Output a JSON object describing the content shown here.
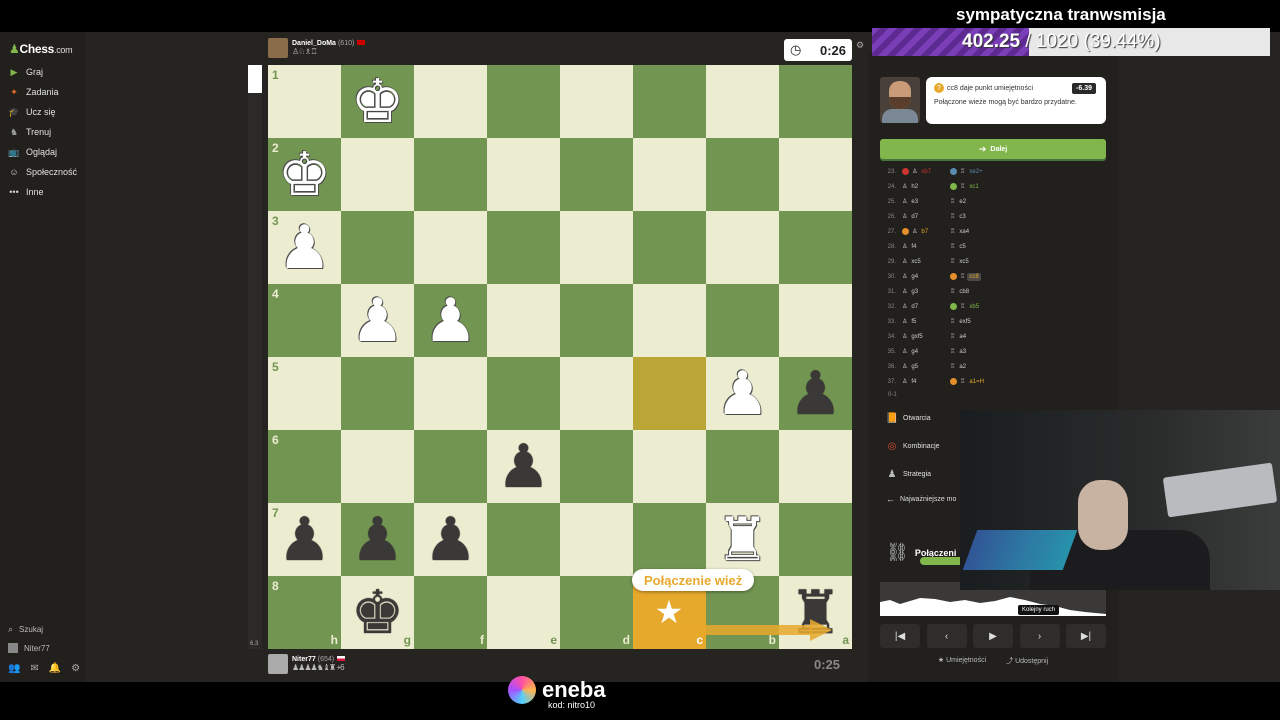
{
  "app": {
    "logo_text": "Chess",
    "logo_domain": ".com"
  },
  "sidebar": {
    "items": [
      {
        "label": "Graj",
        "icon": "play-icon",
        "color": "#81b64c"
      },
      {
        "label": "Zadania",
        "icon": "puzzle-icon",
        "color": "#e76b2a"
      },
      {
        "label": "Ucz się",
        "icon": "learn-icon",
        "color": "#4aa7c9"
      },
      {
        "label": "Trenuj",
        "icon": "train-icon",
        "color": "#a0a0a0"
      },
      {
        "label": "Oglądaj",
        "icon": "watch-icon",
        "color": "#d0d0d0"
      },
      {
        "label": "Społeczność",
        "icon": "community-icon",
        "color": "#d0d0d0"
      },
      {
        "label": "Inne",
        "icon": "more-icon",
        "color": "#d0d0d0"
      }
    ],
    "search_label": "Szukaj",
    "user_label": "Niter77"
  },
  "top_player": {
    "name": "Daniel_DoMa",
    "rating": "(610)",
    "clock": "0:26"
  },
  "bottom_player": {
    "name": "Niter77",
    "rating": "(654)",
    "captured_extra": "+6",
    "clock": "0:25"
  },
  "board": {
    "ranks": [
      "1",
      "2",
      "3",
      "4",
      "5",
      "6",
      "7",
      "8"
    ],
    "files": [
      "h",
      "g",
      "f",
      "e",
      "d",
      "c",
      "b",
      "a"
    ],
    "pieces": [
      {
        "rank": 1,
        "file": "g",
        "piece": "K",
        "color": "w"
      },
      {
        "rank": 2,
        "file": "h",
        "piece": "K",
        "color": "w"
      },
      {
        "rank": 3,
        "file": "h",
        "piece": "P",
        "color": "w"
      },
      {
        "rank": 4,
        "file": "g",
        "piece": "P",
        "color": "w"
      },
      {
        "rank": 4,
        "file": "f",
        "piece": "P",
        "color": "w"
      },
      {
        "rank": 5,
        "file": "b",
        "piece": "P",
        "color": "w"
      },
      {
        "rank": 5,
        "file": "a",
        "piece": "P",
        "color": "b"
      },
      {
        "rank": 6,
        "file": "e",
        "piece": "P",
        "color": "b"
      },
      {
        "rank": 7,
        "file": "h",
        "piece": "P",
        "color": "b"
      },
      {
        "rank": 7,
        "file": "g",
        "piece": "P",
        "color": "b"
      },
      {
        "rank": 7,
        "file": "f",
        "piece": "P",
        "color": "b"
      },
      {
        "rank": 7,
        "file": "b",
        "piece": "R",
        "color": "w"
      },
      {
        "rank": 8,
        "file": "g",
        "piece": "K",
        "color": "b"
      },
      {
        "rank": 8,
        "file": "a",
        "piece": "R",
        "color": "b"
      }
    ],
    "callout": "Połączenie wież",
    "eval_value": "6.3"
  },
  "coach": {
    "move_text": "cc8 daje punkt umiejętności",
    "score": "-6.39",
    "message": "Połączone wieże mogą być bardzo przydatne."
  },
  "next_button": "Dalej",
  "moves": [
    {
      "num": "23.",
      "white": "xb7",
      "wmark": "blunder",
      "wclass": "red",
      "black": "xe2+",
      "bmark": "great",
      "bclass": "blue"
    },
    {
      "num": "24.",
      "white": "h2",
      "wmark": "",
      "wclass": "",
      "black": "xc1",
      "bmark": "best",
      "bclass": "green"
    },
    {
      "num": "25.",
      "white": "e3",
      "wmark": "",
      "wclass": "",
      "black": "e2",
      "bmark": "",
      "bclass": ""
    },
    {
      "num": "26.",
      "white": "d7",
      "wmark": "",
      "wclass": "",
      "black": "c3",
      "bmark": "",
      "bclass": ""
    },
    {
      "num": "27.",
      "white": "b7",
      "wmark": "mistake",
      "wclass": "orange",
      "black": "xa4",
      "bmark": "",
      "bclass": ""
    },
    {
      "num": "28.",
      "white": "f4",
      "wmark": "",
      "wclass": "",
      "black": "c5",
      "bmark": "",
      "bclass": ""
    },
    {
      "num": "29.",
      "white": "xc5",
      "wmark": "",
      "wclass": "",
      "black": "xc5",
      "bmark": "",
      "bclass": ""
    },
    {
      "num": "30.",
      "white": "g4",
      "wmark": "",
      "wclass": "",
      "black": "cc8",
      "bmark": "mistake",
      "bclass": "active"
    },
    {
      "num": "31.",
      "white": "g3",
      "wmark": "",
      "wclass": "",
      "black": "cb8",
      "bmark": "",
      "bclass": ""
    },
    {
      "num": "32.",
      "white": "d7",
      "wmark": "",
      "wclass": "",
      "black": "xb5",
      "bmark": "best",
      "bclass": "green"
    },
    {
      "num": "33.",
      "white": "f5",
      "wmark": "",
      "wclass": "",
      "black": "exf5",
      "bmark": "",
      "bclass": ""
    },
    {
      "num": "34.",
      "white": "gxf5",
      "wmark": "",
      "wclass": "",
      "black": "a4",
      "bmark": "",
      "bclass": ""
    },
    {
      "num": "35.",
      "white": "g4",
      "wmark": "",
      "wclass": "",
      "black": "a3",
      "bmark": "",
      "bclass": ""
    },
    {
      "num": "36.",
      "white": "g5",
      "wmark": "",
      "wclass": "",
      "black": "a2",
      "bmark": "",
      "bclass": ""
    },
    {
      "num": "37.",
      "white": "f4",
      "wmark": "",
      "wclass": "",
      "black": "a1=H",
      "bmark": "mistake",
      "bclass": "orange"
    }
  ],
  "result": "0-1",
  "sections": [
    {
      "label": "Otwarcia",
      "icon": "book-icon",
      "color": "#c89b5a"
    },
    {
      "label": "Kombinacje",
      "icon": "target-icon",
      "color": "#e04a3a"
    },
    {
      "label": "Strategia",
      "icon": "strategy-icon",
      "color": "#bbbbbb"
    }
  ],
  "back_label": "Najważniejsze mo",
  "theme": {
    "name": "Połączeni",
    "progress": 0.5
  },
  "graph_tip": "Kolejny ruch",
  "controls": [
    "first-move-icon",
    "prev-move-icon",
    "play-icon",
    "next-move-icon",
    "last-move-icon"
  ],
  "footer": {
    "skills": "Umiejętności",
    "share": "Udostępnij"
  },
  "overlay": {
    "stream_title": "sympatyczna tranwsmisja",
    "progress_current": "402.25",
    "progress_rest": " / 1020 (39.44%)",
    "progress_fraction": 0.3944
  },
  "sponsor": {
    "brand": "eneba",
    "code": "kod: nitro10"
  }
}
